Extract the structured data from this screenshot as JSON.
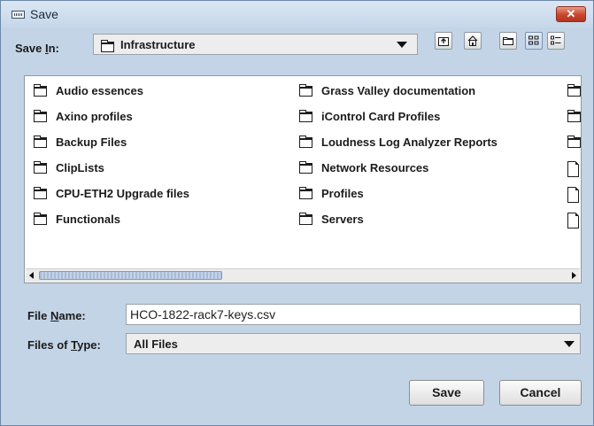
{
  "window": {
    "title": "Save",
    "close_glyph": "✕"
  },
  "save_in": {
    "label_pre": "Save ",
    "label_u": "I",
    "label_post": "n:",
    "value": "Infrastructure"
  },
  "toolbar": {
    "icons": [
      "up-one-level-icon",
      "home-icon",
      "new-folder-icon",
      "list-view-icon",
      "details-view-icon"
    ],
    "active": "list-view-icon"
  },
  "files": {
    "col1": [
      "Audio essences",
      "Axino profiles",
      "Backup Files",
      "ClipLists",
      "CPU-ETH2 Upgrade files",
      "Functionals"
    ],
    "col2": [
      "Grass Valley documentation",
      "iControl Card Profiles",
      "Loudness Log Analyzer Reports",
      "Network Resources",
      "Profiles",
      "Servers"
    ],
    "col3_types": [
      "folder",
      "folder",
      "folder",
      "doc",
      "doc",
      "doc"
    ]
  },
  "file_name": {
    "label_pre": "File ",
    "label_u": "N",
    "label_post": "ame:",
    "value": "HCO-1822-rack7-keys.csv"
  },
  "file_type": {
    "label_pre": "Files of ",
    "label_u": "T",
    "label_post": "ype:",
    "value": "All Files"
  },
  "buttons": {
    "save": "Save",
    "cancel": "Cancel"
  }
}
